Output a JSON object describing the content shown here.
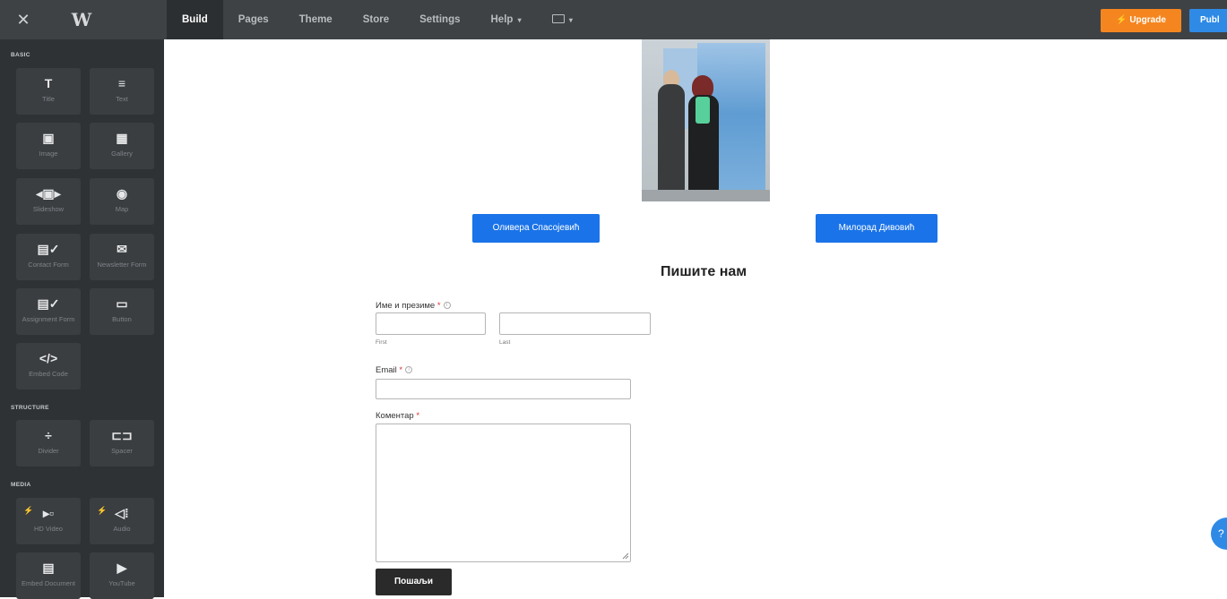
{
  "topbar": {
    "close_glyph": "✕",
    "logo_glyph": "W",
    "nav": [
      {
        "label": "Build",
        "active": true
      },
      {
        "label": "Pages"
      },
      {
        "label": "Theme"
      },
      {
        "label": "Store"
      },
      {
        "label": "Settings"
      },
      {
        "label": "Help"
      }
    ],
    "help_caret": "▾",
    "upgrade_label": "⚡ Upgrade",
    "publish_label": "Publ",
    "colors": {
      "bar": "#3f4245",
      "upgrade": "#f5861f",
      "publish": "#2f8ae6"
    }
  },
  "sidebar": {
    "sections": {
      "basic": "BASIC",
      "structure": "STRUCTURE",
      "media": "MEDIA"
    },
    "tiles": [
      {
        "icon": "T",
        "label": "Title",
        "icon_name": "title-icon"
      },
      {
        "icon": "≡",
        "label": "Text",
        "icon_name": "text-icon"
      },
      {
        "icon": "▣",
        "label": "Image",
        "icon_name": "image-icon"
      },
      {
        "icon": "▦",
        "label": "Gallery",
        "icon_name": "gallery-icon"
      },
      {
        "icon": "◂▣▸",
        "label": "Slideshow",
        "icon_name": "slideshow-icon"
      },
      {
        "icon": "◉",
        "label": "Map",
        "icon_name": "map-pin-icon"
      },
      {
        "icon": "▤✓",
        "label": "Contact Form",
        "icon_name": "contact-form-icon"
      },
      {
        "icon": "✉",
        "label": "Newsletter Form",
        "icon_name": "newsletter-icon"
      },
      {
        "icon": "▤✓",
        "label": "Assignment Form",
        "icon_name": "assignment-form-icon"
      },
      {
        "icon": "▭",
        "label": "Button",
        "icon_name": "button-icon"
      },
      {
        "icon": "</>",
        "label": "Embed Code",
        "icon_name": "embed-code-icon"
      },
      {
        "icon": "÷",
        "label": "Divider",
        "icon_name": "divider-icon"
      },
      {
        "icon": "⊏⊐",
        "label": "Spacer",
        "icon_name": "spacer-icon"
      },
      {
        "icon": "▸▫",
        "label": "HD Video",
        "icon_name": "hd-video-icon"
      },
      {
        "icon": "◁⁞",
        "label": "Audio",
        "icon_name": "audio-icon"
      },
      {
        "icon": "▤",
        "label": "Embed Document",
        "icon_name": "document-icon"
      },
      {
        "icon": "▶",
        "label": "YouTube",
        "icon_name": "youtube-icon"
      }
    ],
    "bolt_glyph": "⚡"
  },
  "content": {
    "buttons": [
      "Оливера Спасојевић",
      "Милорад Дивовић"
    ],
    "heading": "Пишите нам",
    "form": {
      "name_label": "Име и презиме",
      "first_label": "First",
      "last_label": "Last",
      "email_label": "Email",
      "comment_label": "Коментар",
      "required_mark": "*",
      "info_glyph": "i",
      "submit_label": "Пошаљи"
    },
    "chat_glyph": "?"
  }
}
